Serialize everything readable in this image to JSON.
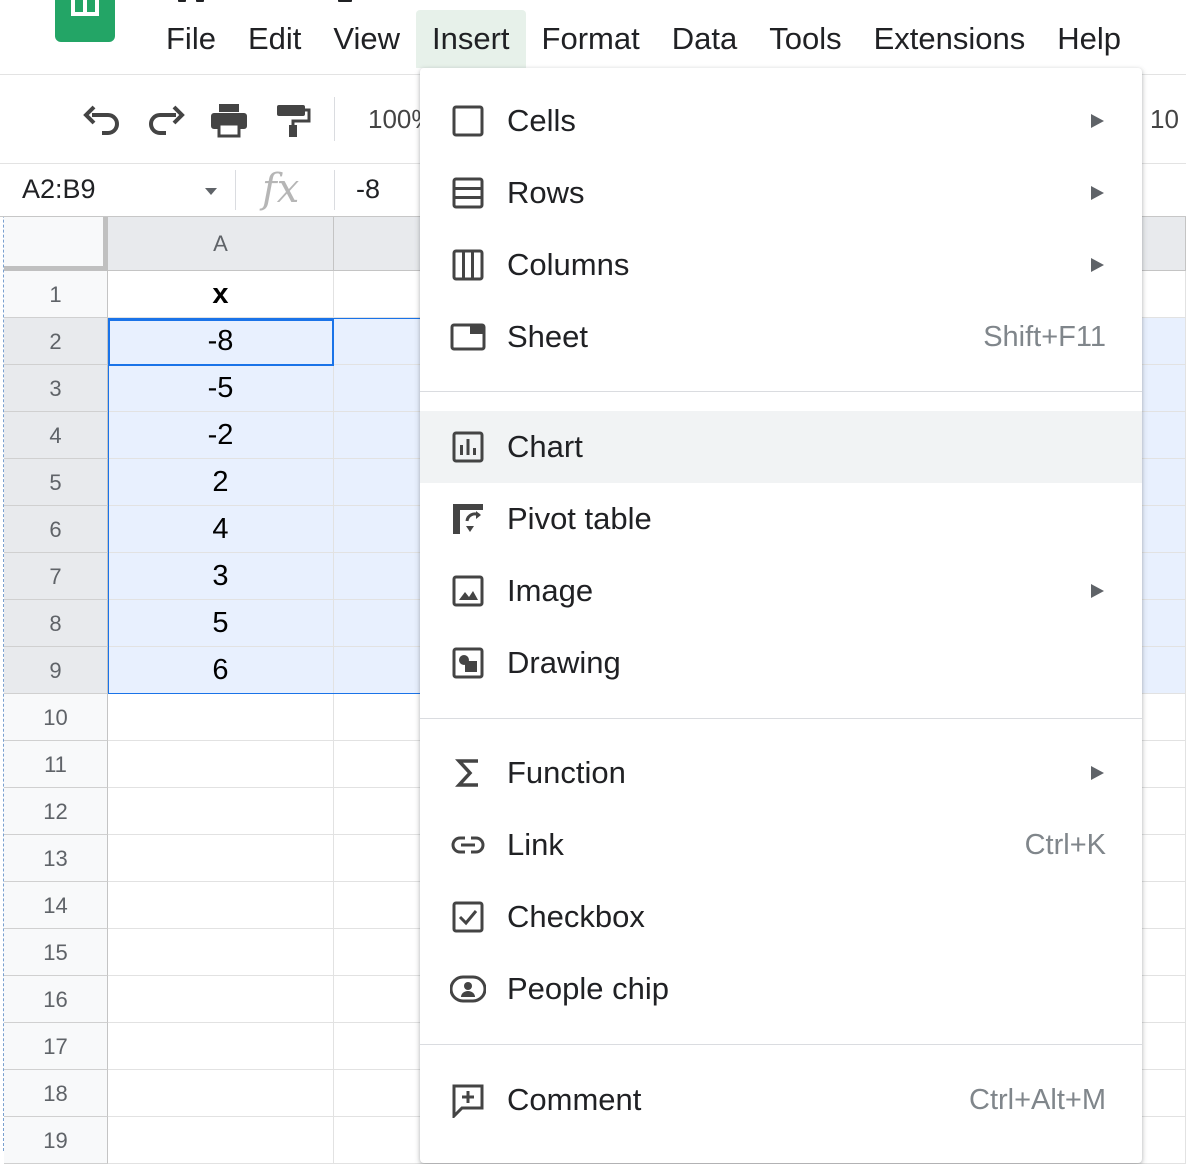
{
  "menubar": {
    "items": [
      "File",
      "Edit",
      "View",
      "Insert",
      "Format",
      "Data",
      "Tools",
      "Extensions",
      "Help"
    ],
    "active": "Insert"
  },
  "toolbar": {
    "undo_icon": "undo-icon",
    "redo_icon": "redo-icon",
    "print_icon": "print-icon",
    "paint_format_icon": "paint-format-icon",
    "zoom": "100%",
    "font_size": "10"
  },
  "formula_bar": {
    "name_box": "A2:B9",
    "fx": "fx",
    "value": "-8"
  },
  "sheet": {
    "columns": [
      "A"
    ],
    "rows": [
      {
        "num": "1",
        "a": "x"
      },
      {
        "num": "2",
        "a": "-8"
      },
      {
        "num": "3",
        "a": "-5"
      },
      {
        "num": "4",
        "a": "-2"
      },
      {
        "num": "5",
        "a": "2"
      },
      {
        "num": "6",
        "a": "4"
      },
      {
        "num": "7",
        "a": "3"
      },
      {
        "num": "8",
        "a": "5"
      },
      {
        "num": "9",
        "a": "6"
      },
      {
        "num": "10",
        "a": ""
      },
      {
        "num": "11",
        "a": ""
      },
      {
        "num": "12",
        "a": ""
      },
      {
        "num": "13",
        "a": ""
      },
      {
        "num": "14",
        "a": ""
      },
      {
        "num": "15",
        "a": ""
      },
      {
        "num": "16",
        "a": ""
      },
      {
        "num": "17",
        "a": ""
      },
      {
        "num": "18",
        "a": ""
      },
      {
        "num": "19",
        "a": ""
      }
    ],
    "selection": "A2:B9"
  },
  "insert_menu": {
    "items": [
      {
        "label": "Cells",
        "shortcut": "",
        "submenu": true,
        "icon": "cells-icon"
      },
      {
        "label": "Rows",
        "shortcut": "",
        "submenu": true,
        "icon": "rows-icon"
      },
      {
        "label": "Columns",
        "shortcut": "",
        "submenu": true,
        "icon": "columns-icon"
      },
      {
        "label": "Sheet",
        "shortcut": "Shift+F11",
        "submenu": false,
        "icon": "sheet-icon"
      },
      {
        "label": "Chart",
        "shortcut": "",
        "submenu": false,
        "icon": "chart-icon",
        "hovered": true
      },
      {
        "label": "Pivot table",
        "shortcut": "",
        "submenu": false,
        "icon": "pivot-table-icon"
      },
      {
        "label": "Image",
        "shortcut": "",
        "submenu": true,
        "icon": "image-icon"
      },
      {
        "label": "Drawing",
        "shortcut": "",
        "submenu": false,
        "icon": "drawing-icon"
      },
      {
        "label": "Function",
        "shortcut": "",
        "submenu": true,
        "icon": "sigma-icon"
      },
      {
        "label": "Link",
        "shortcut": "Ctrl+K",
        "submenu": false,
        "icon": "link-icon"
      },
      {
        "label": "Checkbox",
        "shortcut": "",
        "submenu": false,
        "icon": "checkbox-icon"
      },
      {
        "label": "People chip",
        "shortcut": "",
        "submenu": false,
        "icon": "people-chip-icon"
      },
      {
        "label": "Comment",
        "shortcut": "Ctrl+Alt+M",
        "submenu": false,
        "icon": "comment-add-icon"
      }
    ]
  },
  "colors": {
    "brand_green": "#23a566",
    "selection_blue": "#1a73e8",
    "selection_fill": "#e8f0fe",
    "active_menu_bg": "#e7f1ea",
    "hover_bg": "#f1f3f4"
  }
}
